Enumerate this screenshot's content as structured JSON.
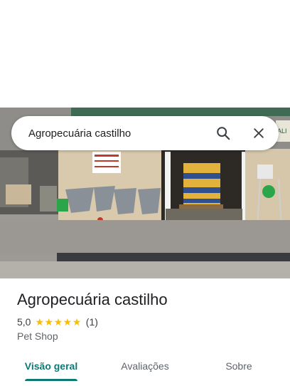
{
  "search": {
    "query": "Agropecuária castilho",
    "search_icon": "search-icon",
    "close_icon": "close-icon"
  },
  "photo": {
    "storefront_sign": "ALI"
  },
  "place": {
    "name": "Agropecuária castilho",
    "rating": "5,0",
    "stars_filled": 5,
    "review_count": "(1)",
    "category": "Pet Shop"
  },
  "tabs": [
    {
      "label": "Visão geral",
      "active": true
    },
    {
      "label": "Avaliações",
      "active": false
    },
    {
      "label": "Sobre",
      "active": false
    }
  ],
  "colors": {
    "accent": "#0b7a75",
    "star": "#fbbc04",
    "title": "#202124",
    "muted": "#5f6368"
  }
}
